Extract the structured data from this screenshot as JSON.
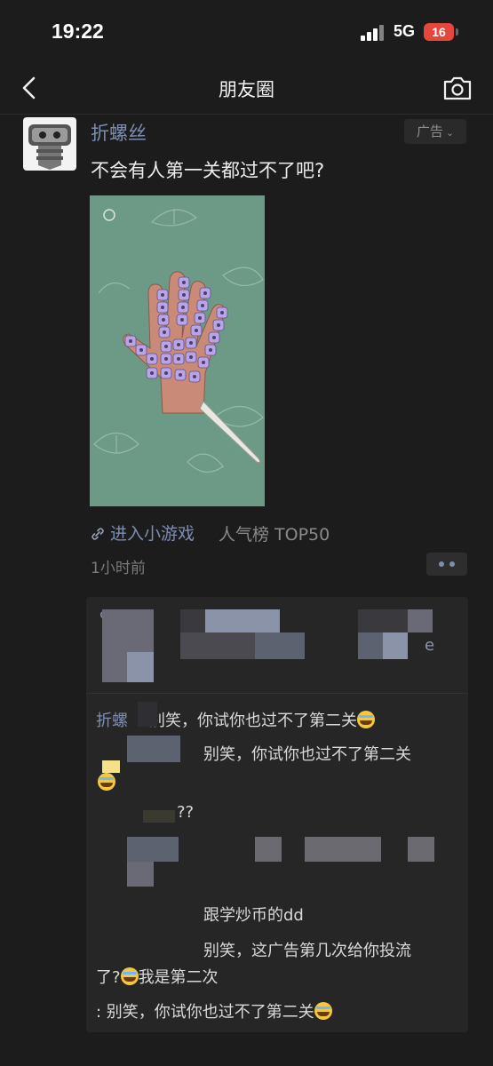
{
  "status_bar": {
    "time": "19:22",
    "network": "5G",
    "battery": "16"
  },
  "nav": {
    "title": "朋友圈"
  },
  "post": {
    "author": "折螺丝",
    "ad_label": "广告",
    "caption": "不会有人第一关都过不了吧?",
    "game_link_label": "进入小游戏",
    "rank_label": "人气榜 TOP50",
    "time": "1小时前"
  },
  "comments": {
    "like_fragment": "e",
    "c1_name": "折螺",
    "c1_text": "别笑，你试你也过不了第二关",
    "c2_text": "别笑，你试你也过不了第二关",
    "c3_text": "??",
    "c4_text": "跟学炒币的dd",
    "c5_text": "别笑，这广告第几次给你投流",
    "c5_cont_a": "了?",
    "c5_cont_b": "我是第二次",
    "c6_text": ": 别笑，你试你也过不了第二关"
  },
  "colors": {
    "link": "#7d8db3",
    "background": "#1c1c1c",
    "panel": "#262626",
    "battery": "#e5473d"
  }
}
